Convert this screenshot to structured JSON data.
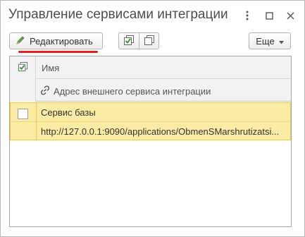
{
  "window": {
    "title": "Управление сервисами интеграции"
  },
  "toolbar": {
    "edit_label": "Редактировать",
    "more_label": "Еще"
  },
  "table": {
    "columns": {
      "name": "Имя",
      "address": "Адрес внешнего сервиса интеграции"
    },
    "rows": [
      {
        "name": "Сервис базы",
        "address": "http://127.0.0.1:9090/applications/ObmenSMarshrutizatsi...",
        "checked": false
      }
    ]
  },
  "colors": {
    "selected_row_bg": "#fbeba5",
    "selected_row_border": "#f2c84b",
    "edit_underline": "#e0201e"
  }
}
